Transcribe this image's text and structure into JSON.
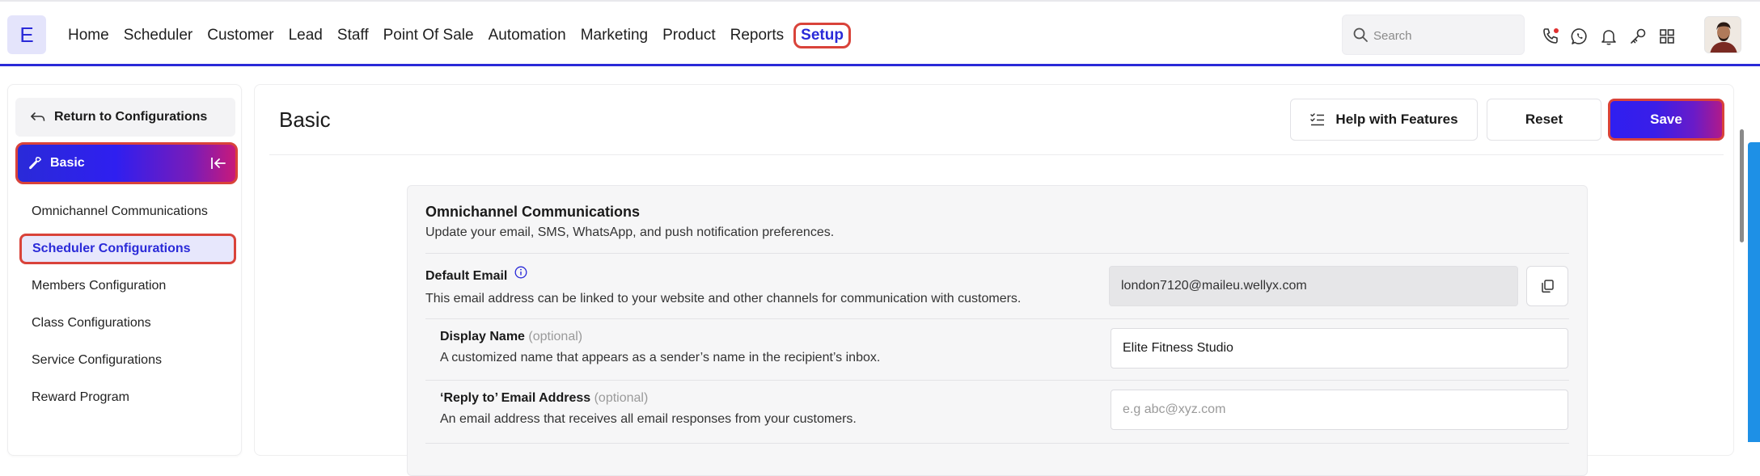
{
  "app": {
    "logo_letter": "E"
  },
  "nav": {
    "items": [
      "Home",
      "Scheduler",
      "Customer",
      "Lead",
      "Staff",
      "Point Of Sale",
      "Automation",
      "Marketing",
      "Product",
      "Reports"
    ],
    "active": "Setup"
  },
  "search": {
    "placeholder": "Search"
  },
  "toolbar_icons": [
    "phone-icon",
    "whatsapp-icon",
    "bell-icon",
    "key-icon",
    "apps-grid-icon"
  ],
  "sidebar": {
    "return_label": "Return to Configurations",
    "section_label": "Basic",
    "items": [
      {
        "label": "Omnichannel Communications",
        "selected": false
      },
      {
        "label": "Scheduler Configurations",
        "selected": true
      },
      {
        "label": "Members Configuration",
        "selected": false
      },
      {
        "label": "Class Configurations",
        "selected": false
      },
      {
        "label": "Service Configurations",
        "selected": false
      },
      {
        "label": "Reward Program",
        "selected": false
      }
    ]
  },
  "main": {
    "title": "Basic",
    "help_label": "Help with Features",
    "reset_label": "Reset",
    "save_label": "Save"
  },
  "card": {
    "title": "Omnichannel Communications",
    "subtitle": "Update your email, SMS, WhatsApp, and push notification preferences.",
    "default_email": {
      "label": "Default Email",
      "desc": "This email address can be linked to your website and other channels for communication with customers.",
      "value": "london7120@maileu.wellyx.com"
    },
    "display_name": {
      "label": "Display Name",
      "optional": "(optional)",
      "desc": "A customized name that appears as a sender’s name in the recipient’s inbox.",
      "value": "Elite Fitness Studio"
    },
    "reply_to": {
      "label": "‘Reply to’ Email Address",
      "optional": "(optional)",
      "desc": "An email address that receives all email responses from your customers.",
      "placeholder": "e.g abc@xyz.com"
    }
  },
  "colors": {
    "accent": "#2a2ad8",
    "highlight": "#d9433a",
    "scroll_accent": "#1e90e6"
  }
}
